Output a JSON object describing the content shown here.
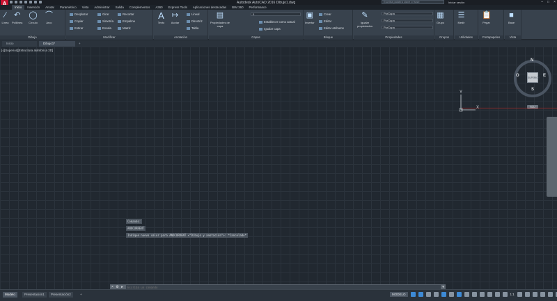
{
  "titlebar": {
    "title": "Autodesk AutoCAD 2016    Dibujo1.dwg",
    "search_placeholder": "Escriba palabra clave o frase",
    "signin": "Iniciar sesión",
    "logo": "A"
  },
  "menu": {
    "tabs": [
      "Inicio",
      "Inserción",
      "Anotar",
      "Paramétrico",
      "Vista",
      "Administrar",
      "Salida",
      "Complementos",
      "A360",
      "Express Tools",
      "Aplicaciones destacadas",
      "BIM 360",
      "Performance"
    ]
  },
  "ribbon": {
    "dibujo": {
      "label": "Dibujo",
      "tools": [
        "Línea",
        "Polilínea",
        "Círculo",
        "Arco"
      ]
    },
    "modificar": {
      "label": "Modificar",
      "tools": [
        "Desplazar",
        "Girar",
        "Recortar",
        "Copiar",
        "Simetría",
        "Empalme",
        "Estirar",
        "Escala",
        "Matriz"
      ]
    },
    "anotacion": {
      "label": "Anotación",
      "tools": [
        "Texto",
        "Acotar",
        "Lineal",
        "Directriz",
        "Tabla"
      ]
    },
    "capas": {
      "label": "Capas",
      "big": "Propiedades de capa",
      "layer": "0",
      "tools": [
        "Establecer como actual",
        "Igualar capa"
      ]
    },
    "bloque": {
      "label": "Bloque",
      "big": "Insertar",
      "tools": [
        "Crear",
        "Editar",
        "Editar atributos"
      ]
    },
    "propiedades": {
      "label": "Propiedades",
      "big": "Igualar propiedades",
      "combos": [
        "PorCapa",
        "PorCapa",
        "PorCapa"
      ]
    },
    "grupos": {
      "label": "Grupos",
      "big": "Grupo"
    },
    "utilidades": {
      "label": "Utilidades",
      "big": "Medir"
    },
    "portapapeles": {
      "label": "Portapapeles",
      "big": "Pegar"
    },
    "vista": {
      "label": "Vista",
      "big": "Base"
    }
  },
  "doctabs": {
    "start": "Inicio",
    "drawing": "Dibujo1*",
    "add": "+"
  },
  "viewport": {
    "label": "[-][Superior][Estructura alámbrica 2D]"
  },
  "viewcube": {
    "face": "SUPERIOR",
    "n": "N",
    "s": "S",
    "e": "E",
    "o": "O",
    "wcs": "SCU"
  },
  "ucs": {
    "x": "X",
    "y": "Y"
  },
  "command": {
    "history": [
      "Comando:",
      "ANOCURRENT",
      "Indique nuevo valor para ANOCURRENT <\"Dibujo y anotación\">: *Cancelado*"
    ],
    "placeholder": "Escriba un comando"
  },
  "status": {
    "layout_tabs": [
      "Modelo",
      "Presentación1",
      "Presentación2"
    ],
    "add": "+",
    "model": "MODELO",
    "scale": "1:1"
  }
}
